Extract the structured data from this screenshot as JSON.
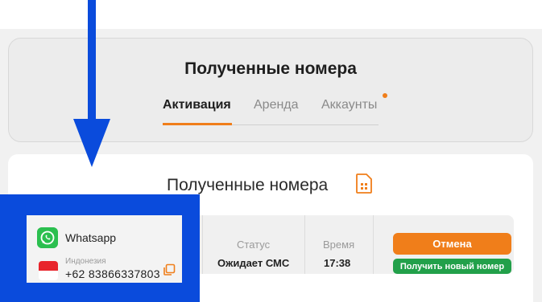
{
  "top_card": {
    "title": "Полученные номера",
    "tabs": [
      {
        "label": "Активация",
        "active": true
      },
      {
        "label": "Аренда",
        "active": false
      },
      {
        "label": "Аккаунты",
        "active": false
      }
    ]
  },
  "main": {
    "title": "Полученные номера",
    "order": {
      "app": "Whatsapp",
      "country": "Индонезия",
      "phone": "+62 83866337803",
      "status_label": "Статус",
      "status_value": "Ожидает СМС",
      "time_label": "Время",
      "time_value": "17:38",
      "cancel_label": "Отмена",
      "new_number_label": "Получить новый номер"
    }
  },
  "colors": {
    "accent": "#f07e1a",
    "green": "#22a04a",
    "highlight": "#0a4bdc"
  },
  "icons": [
    "sim-card-icon",
    "whatsapp-icon",
    "indonesia-flag-icon",
    "copy-icon",
    "down-arrow-annotation"
  ]
}
